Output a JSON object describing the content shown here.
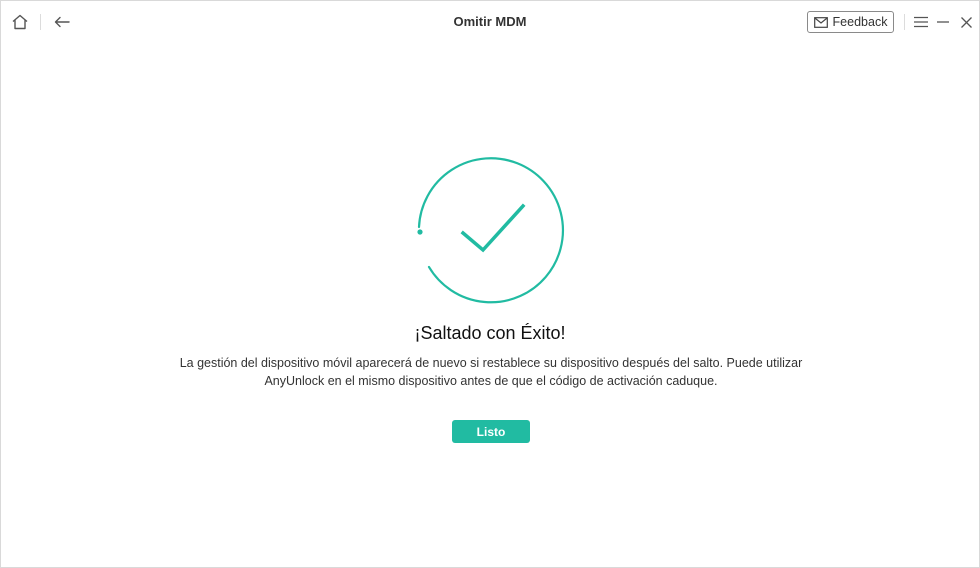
{
  "window": {
    "title": "Omitir MDM"
  },
  "toolbar": {
    "feedback_label": "Feedback",
    "icons": [
      "home-icon",
      "back-arrow-icon",
      "mail-icon",
      "menu-icon",
      "minimize-icon",
      "close-icon"
    ]
  },
  "result": {
    "title": "¡Saltado con Éxito!",
    "description_line1": "La gestión del dispositivo móvil aparecerá de nuevo si restablece su dispositivo después del salto. Puede utilizar",
    "description_line2": "AnyUnlock en el mismo dispositivo antes de que el código de activación caduque.",
    "done_label": "Listo"
  },
  "colors": {
    "accent": "#21bba2",
    "text": "#333333"
  }
}
